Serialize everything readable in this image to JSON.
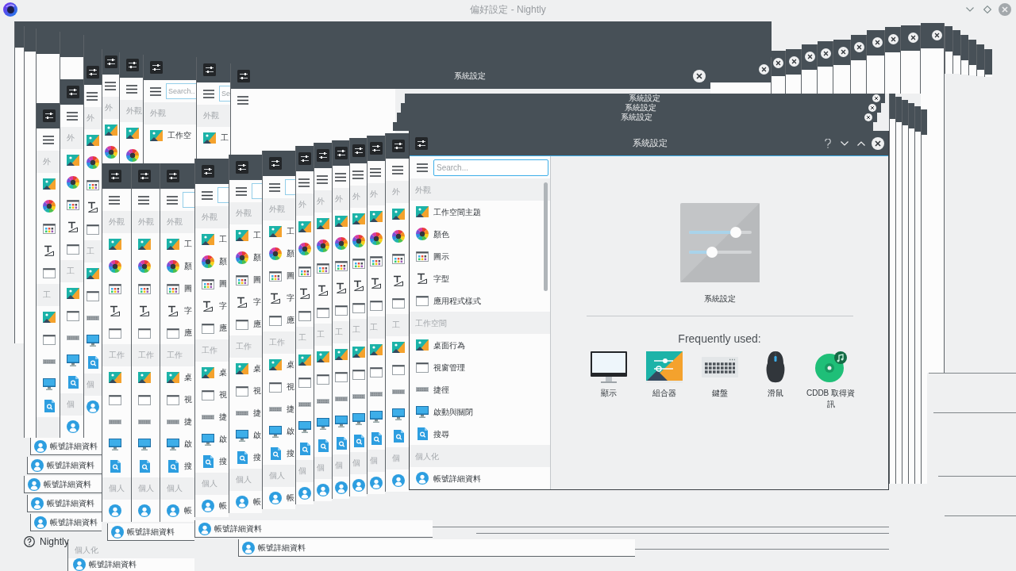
{
  "app_window": {
    "title": "偏好設定 - Nightly",
    "footer_label": "Nightly"
  },
  "settings_window": {
    "title": "系統設定",
    "search": {
      "placeholder": "Search..."
    },
    "sidebar": [
      {
        "kind": "header",
        "label": "外觀"
      },
      {
        "kind": "item",
        "label": "工作空間主題",
        "selected": false
      },
      {
        "kind": "item",
        "label": "顏色",
        "selected": false
      },
      {
        "kind": "item",
        "label": "圖示",
        "selected": false
      },
      {
        "kind": "item",
        "label": "字型",
        "selected": false
      },
      {
        "kind": "item",
        "label": "應用程式樣式",
        "selected": false
      },
      {
        "kind": "header",
        "label": "工作空間"
      },
      {
        "kind": "item",
        "label": "桌面行為",
        "selected": false
      },
      {
        "kind": "item",
        "label": "視窗管理",
        "selected": false
      },
      {
        "kind": "item",
        "label": "捷徑",
        "selected": false
      },
      {
        "kind": "item",
        "label": "啟動與關閉",
        "selected": false
      },
      {
        "kind": "item",
        "label": "搜尋",
        "selected": false
      },
      {
        "kind": "header",
        "label": "個人化"
      },
      {
        "kind": "item",
        "label": "帳號詳細資料",
        "selected": false
      }
    ],
    "overview": {
      "label": "系統設定"
    },
    "frequently_used": {
      "heading": "Frequently used:",
      "items": [
        {
          "label": "顯示"
        },
        {
          "label": "組合器"
        },
        {
          "label": "鍵盤"
        },
        {
          "label": "滑鼠"
        },
        {
          "label": "CDDB 取得資訊"
        }
      ]
    }
  },
  "window_trail": {
    "upper_copies": [
      {
        "headers": [
          "外"
        ]
      },
      {
        "headers": [
          "外觀"
        ]
      },
      {
        "placeholder": "Search..",
        "headers": [
          "外觀"
        ],
        "items": [
          "工作空"
        ]
      },
      {
        "placeholder": "Se",
        "headers": [
          "外觀"
        ],
        "items": [
          "工"
        ]
      }
    ],
    "left_copies": [
      {
        "headers": [
          "外",
          "工"
        ]
      },
      {
        "headers": [
          "外",
          "工",
          "個"
        ]
      },
      {
        "headers": [
          "外",
          "工",
          "個"
        ]
      }
    ],
    "stacked_titles": [
      {
        "title": "系統設定"
      },
      {
        "title": "系統設定"
      },
      {
        "title": "系統設定"
      },
      {
        "title": "系統設定"
      }
    ],
    "front_copies": [
      {
        "headers": [
          "外觀",
          "工作",
          "個人"
        ]
      },
      {
        "headers": [
          "外觀",
          "工作",
          "個人"
        ]
      },
      {
        "headers": [
          "外觀",
          "工作",
          "個人"
        ],
        "items": [
          "工",
          "顏",
          "圖",
          "字",
          "應",
          "桌",
          "視",
          "捷",
          "啟",
          "搜",
          "帳"
        ]
      },
      {
        "headers": [
          "外觀",
          "工作",
          "個人"
        ],
        "items": [
          "工",
          "顏",
          "圖",
          "字",
          "應",
          "桌",
          "視",
          "捷",
          "啟",
          "搜",
          "帳"
        ]
      },
      {
        "headers": [
          "外觀",
          "工作",
          "個人"
        ],
        "items": [
          "工",
          "顏",
          "圖",
          "字",
          "應",
          "桌",
          "視",
          "捷",
          "啟",
          "搜",
          "帳"
        ]
      },
      {
        "headers": [
          "外觀",
          "工作",
          "個人"
        ],
        "items": [
          "工",
          "顏",
          "圖",
          "字",
          "應",
          "桌",
          "視",
          "捷",
          "啟",
          "搜",
          "帳"
        ]
      },
      {
        "headers": [
          "外",
          "工",
          "個"
        ]
      },
      {
        "headers": [
          "外",
          "工",
          "個"
        ]
      },
      {
        "headers": [
          "外",
          "工",
          "個"
        ]
      },
      {
        "headers": [
          "外",
          "工",
          "個"
        ]
      },
      {
        "headers": [
          "外",
          "工",
          "個"
        ]
      },
      {
        "headers": [
          "外",
          "工",
          "個"
        ]
      }
    ],
    "bottom_rows": [
      {
        "label": "帳號詳細資料"
      },
      {
        "label": "帳號詳細資料"
      },
      {
        "label": "帳號詳細資料"
      },
      {
        "label": "帳號詳細資料"
      },
      {
        "label": "帳號詳細資料"
      },
      {
        "label": "帳號詳細資料"
      },
      {
        "label": "帳號詳細資料"
      },
      {
        "label": "帳號詳細資料"
      }
    ],
    "bottom_section": {
      "header": "個人化",
      "label": "帳號詳細資料"
    }
  }
}
